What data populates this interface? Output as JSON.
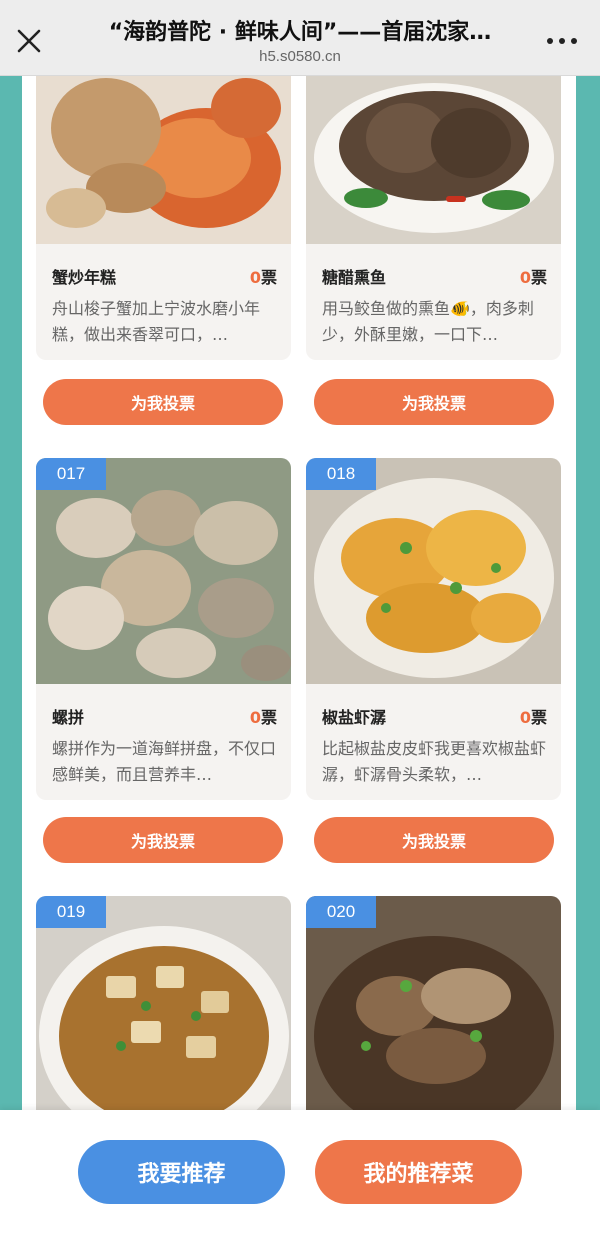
{
  "header": {
    "title": "“海韵普陀 · 鲜味人间”——首届沈家…",
    "domain": "h5.s0580.cn",
    "close_icon": "close-icon",
    "more_icon": "more-dots-icon"
  },
  "votes_unit": "票",
  "vote_button_label": "为我投票",
  "cards": [
    {
      "number": "",
      "name": "蟹炒年糕",
      "votes": "0",
      "desc": "舟山梭子蟹加上宁波水磨小年糕，做出来香翠可口，…"
    },
    {
      "number": "",
      "name": "糖醋熏鱼",
      "votes": "0",
      "desc": "用马鲛鱼做的熏鱼🐠，肉多刺少，外酥里嫩，一口下…"
    },
    {
      "number": "017",
      "name": "螺拼",
      "votes": "0",
      "desc": "螺拼作为一道海鲜拼盘，不仅口感鲜美，而且营养丰…"
    },
    {
      "number": "018",
      "name": "椒盐虾潺",
      "votes": "0",
      "desc": "比起椒盐皮皮虾我更喜欢椒盐虾潺，虾潺骨头柔软，…"
    },
    {
      "number": "019",
      "name": "",
      "votes": "",
      "desc": ""
    },
    {
      "number": "020",
      "name": "",
      "votes": "",
      "desc": ""
    }
  ],
  "bottom": {
    "recommend_label": "我要推荐",
    "my_recommend_label": "我的推荐菜"
  },
  "colors": {
    "accent_orange": "#ee764a",
    "accent_blue": "#4a90e2",
    "side_teal": "#5bb8b0"
  }
}
